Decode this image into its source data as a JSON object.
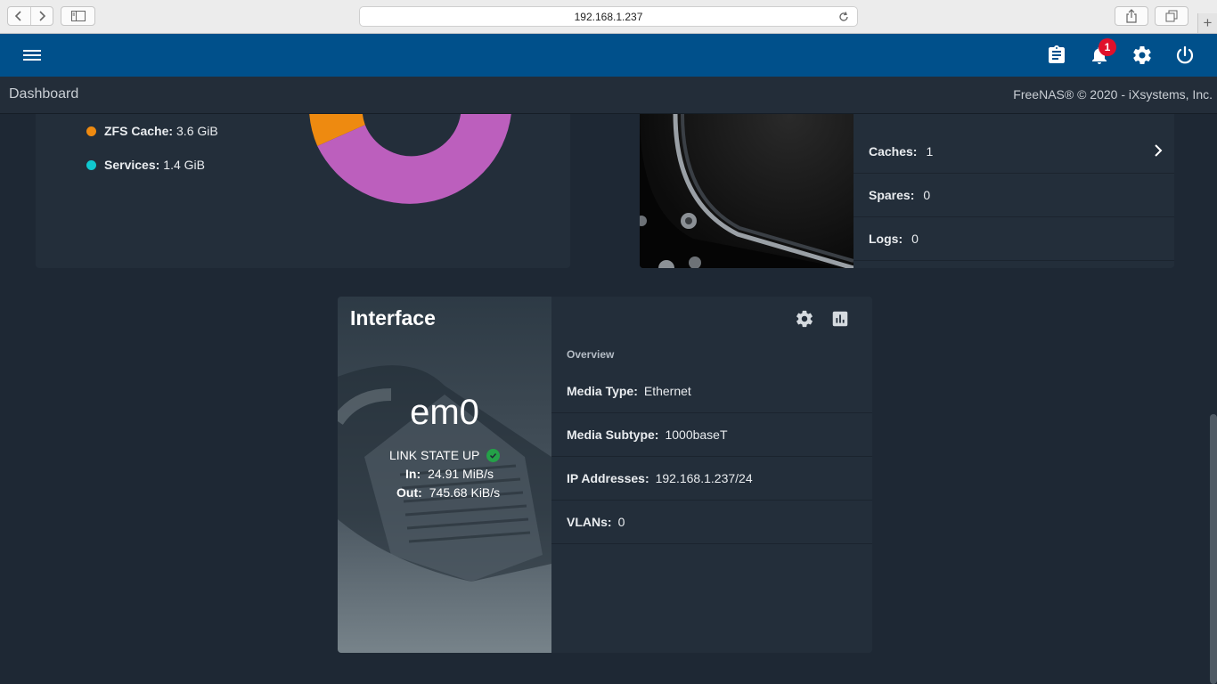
{
  "browser": {
    "url": "192.168.1.237"
  },
  "toolbar": {
    "notification_count": "1"
  },
  "breadcrumb": {
    "title": "Dashboard",
    "copyright": "FreeNAS® © 2020 - iXsystems, Inc."
  },
  "memory": {
    "legend": [
      {
        "label": "ZFS Cache:",
        "value": "3.6 GiB",
        "color": "#ee8a10"
      },
      {
        "label": "Services:",
        "value": "1.4 GiB",
        "color": "#10c8d0"
      }
    ],
    "chart_colors": [
      "#ee8a10",
      "#bc5fbd"
    ]
  },
  "pool": {
    "rows": [
      {
        "label": "Caches:",
        "value": "1"
      },
      {
        "label": "Spares:",
        "value": "0"
      },
      {
        "label": "Logs:",
        "value": "0"
      }
    ]
  },
  "interface": {
    "title": "Interface",
    "name": "em0",
    "link_state": "LINK STATE UP",
    "in_label": "In:",
    "in_value": "24.91 MiB/s",
    "out_label": "Out:",
    "out_value": "745.68 KiB/s",
    "overview_title": "Overview",
    "rows": [
      {
        "label": "Media Type:",
        "value": "Ethernet"
      },
      {
        "label": "Media Subtype:",
        "value": "1000baseT"
      },
      {
        "label": "IP Addresses:",
        "value": "192.168.1.237/24"
      },
      {
        "label": "VLANs:",
        "value": "0"
      }
    ]
  }
}
